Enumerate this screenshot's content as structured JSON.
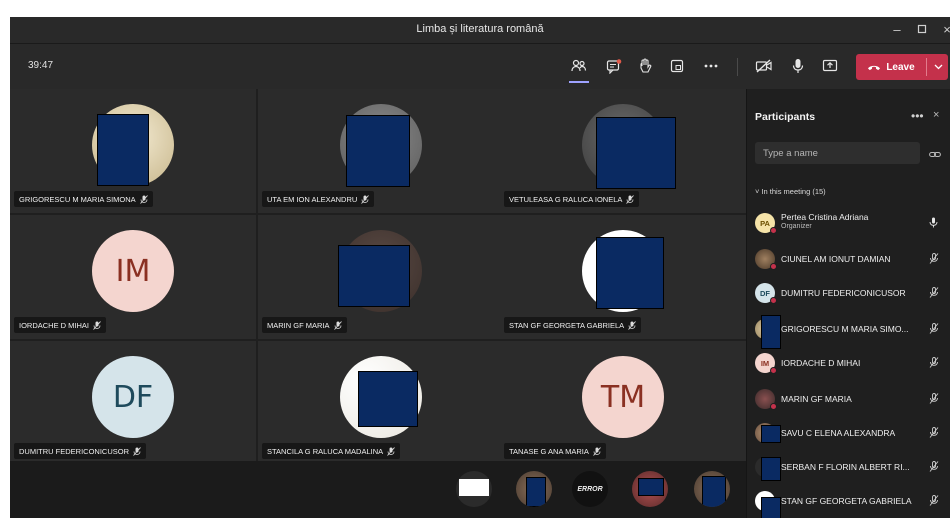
{
  "window": {
    "title": "Limba și literatura română",
    "minimize_icon": "minimize-icon",
    "maximize_icon": "maximize-icon",
    "close_icon": "close-icon"
  },
  "toolbar": {
    "timer": "39:47",
    "buttons": [
      "people-icon",
      "chat-icon",
      "raise-hand-icon",
      "share-tray-icon",
      "more-icon",
      "camera-off-icon",
      "microphone-icon",
      "share-screen-icon"
    ],
    "leave_label": "Leave",
    "leave_color": "#c4314b",
    "accent": "#9ea2ff"
  },
  "stage": {
    "tiles": [
      {
        "name": "GRIGORESCU M MARIA SIMONA",
        "type": "photo"
      },
      {
        "name": "UTA EM ION ALEXANDRU",
        "type": "photo"
      },
      {
        "name": "VETULEASA G RALUCA IONELA",
        "type": "photo"
      },
      {
        "name": "IORDACHE D MIHAI",
        "type": "initials",
        "initials": "IM",
        "bg": "#f4d5cf",
        "fg": "#8a3022"
      },
      {
        "name": "MARIN GF MARIA",
        "type": "photo"
      },
      {
        "name": "STAN GF GEORGETA GABRIELA",
        "type": "photo"
      },
      {
        "name": "DUMITRU FEDERICONICUSOR",
        "type": "initials",
        "initials": "DF",
        "bg": "#d5e4ea",
        "fg": "#1e4a5c"
      },
      {
        "name": "STANCILA G RALUCA MADALINA",
        "type": "photo"
      },
      {
        "name": "TANASE G ANA MARIA",
        "type": "initials",
        "initials": "TM",
        "bg": "#f4d5cf",
        "fg": "#8a3022"
      }
    ],
    "strip_error_label": "ERROR"
  },
  "sidebar": {
    "title": "Participants",
    "search_placeholder": "Type a name",
    "section_label": "In this meeting (15)",
    "participants": [
      {
        "name": "Pertea Cristina Adriana",
        "role": "Organizer",
        "initials": "PA",
        "mic": "on"
      },
      {
        "name": "CIUNEL AM IONUT DAMIAN",
        "mic": "off"
      },
      {
        "name": "DUMITRU FEDERICONICUSOR",
        "initials": "DF",
        "mic": "off"
      },
      {
        "name": "GRIGORESCU M MARIA SIMO...",
        "mic": "off"
      },
      {
        "name": "IORDACHE D MIHAI",
        "initials": "IM",
        "mic": "off"
      },
      {
        "name": "MARIN GF MARIA",
        "mic": "off"
      },
      {
        "name": "SAVU C ELENA ALEXANDRA",
        "mic": "off"
      },
      {
        "name": "SERBAN F FLORIN ALBERT RI...",
        "mic": "off"
      },
      {
        "name": "STAN GF GEORGETA GABRIELA",
        "mic": "off"
      }
    ]
  }
}
